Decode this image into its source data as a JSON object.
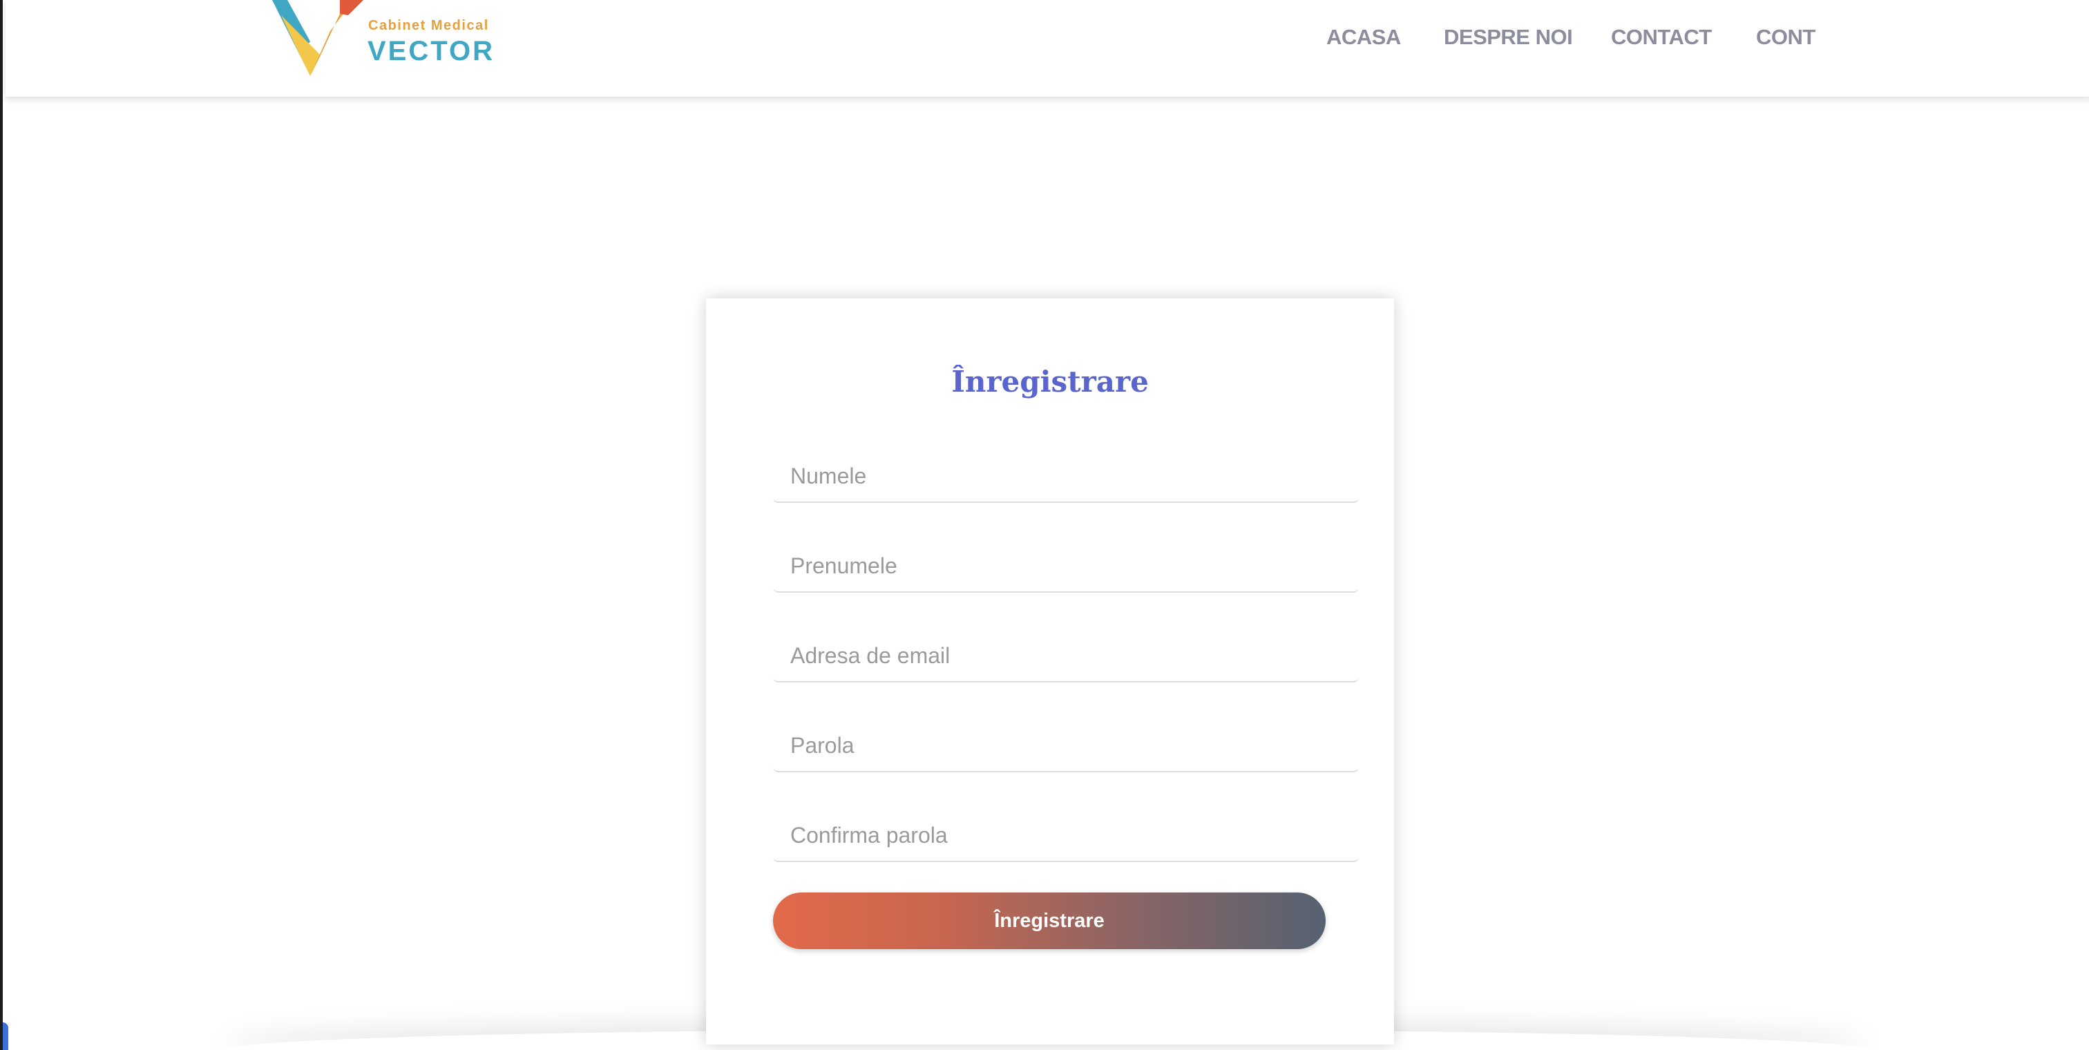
{
  "logo": {
    "subtitle": "Cabinet Medical",
    "name": "VECTOR"
  },
  "nav": {
    "items": [
      "ACASA",
      "DESPRE NOI",
      "CONTACT",
      "CONT"
    ]
  },
  "form": {
    "title": "Înregistrare",
    "fields": {
      "last_name_placeholder": "Numele",
      "first_name_placeholder": "Prenumele",
      "email_placeholder": "Adresa de email",
      "password_placeholder": "Parola",
      "confirm_password_placeholder": "Confirma parola"
    },
    "submit_label": "Înregistrare"
  },
  "colors": {
    "title": "#5965cc",
    "nav_text": "#8b8c9c",
    "logo_teal": "#3fa6c4",
    "logo_orange": "#e8a03c",
    "button_gradient_start": "#e2694a",
    "button_gradient_end": "#566272"
  }
}
